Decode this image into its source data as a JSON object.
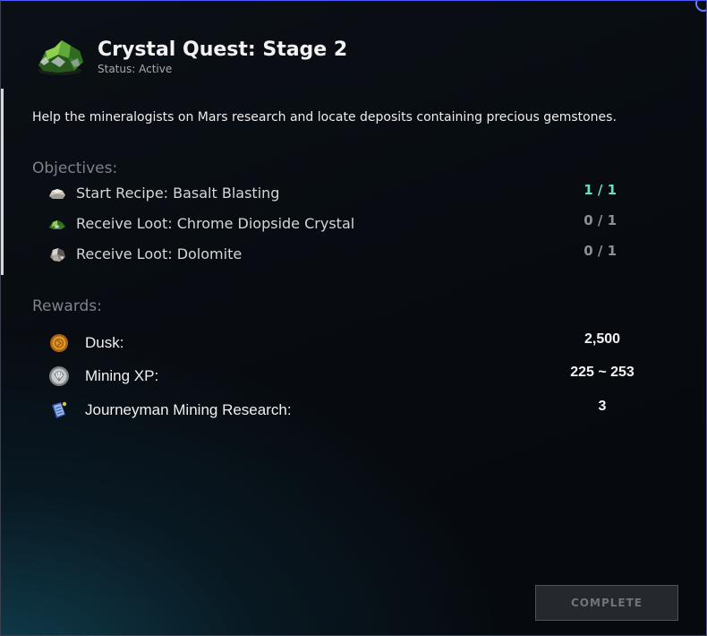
{
  "quest": {
    "title": "Crystal Quest: Stage 2",
    "status": "Status: Active",
    "description": "Help the mineralogists on Mars research and locate deposits containing precious gemstones."
  },
  "objectives": {
    "heading": "Objectives:",
    "items": [
      {
        "label": "Start Recipe: Basalt Blasting",
        "progress": "1 / 1",
        "icon": "basalt-rock-icon"
      },
      {
        "label": "Receive Loot: Chrome Diopside Crystal",
        "progress": "0 / 1",
        "icon": "green-crystal-icon"
      },
      {
        "label": "Receive Loot: Dolomite",
        "progress": "0 / 1",
        "icon": "dolomite-icon"
      }
    ]
  },
  "rewards": {
    "heading": "Rewards:",
    "items": [
      {
        "label": "Dusk:",
        "value": "2,500",
        "icon": "dusk-coin-icon"
      },
      {
        "label": "Mining XP:",
        "value": "225 ~ 253",
        "icon": "mining-xp-icon"
      },
      {
        "label": "Journeyman Mining Research:",
        "value": "3",
        "icon": "research-book-icon"
      }
    ]
  },
  "actions": {
    "complete_label": "COMPLETE"
  },
  "colors": {
    "done": "#63e0c6",
    "pending": "#8d9096",
    "muted_heading": "#7e8289"
  }
}
